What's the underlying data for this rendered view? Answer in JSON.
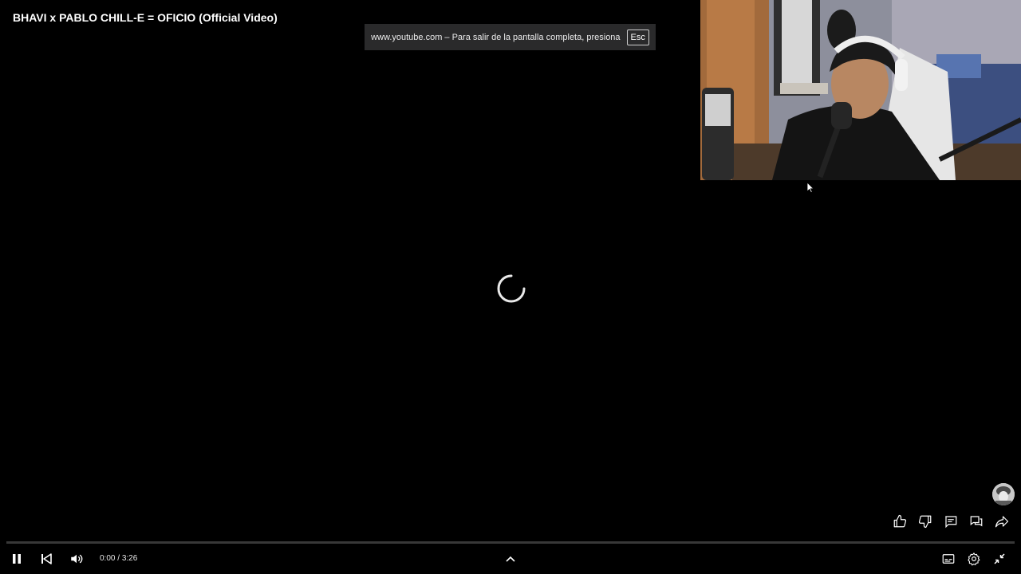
{
  "video": {
    "title": "BHAVI x PABLO CHILL-E = OFICIO (Official Video)"
  },
  "fullscreen_notice": {
    "text": "www.youtube.com – Para salir de la pantalla completa, presiona",
    "key": "Esc"
  },
  "player": {
    "current_time": "0:00",
    "separator": " / ",
    "duration": "3:26",
    "progress_fraction": 0.0,
    "accent_color": "#ff0000",
    "state": "loading"
  },
  "icons": {
    "pause": "pause-icon",
    "previous": "previous-icon",
    "volume": "volume-icon",
    "expand": "chevron-up-icon",
    "subtitles": "subtitles-icon",
    "settings": "gear-icon",
    "exit_fullscreen": "exit-fullscreen-icon",
    "like": "thumbs-up-icon",
    "dislike": "thumbs-down-icon",
    "comments": "comment-icon",
    "live_chat": "chat-icon",
    "share": "share-icon"
  }
}
